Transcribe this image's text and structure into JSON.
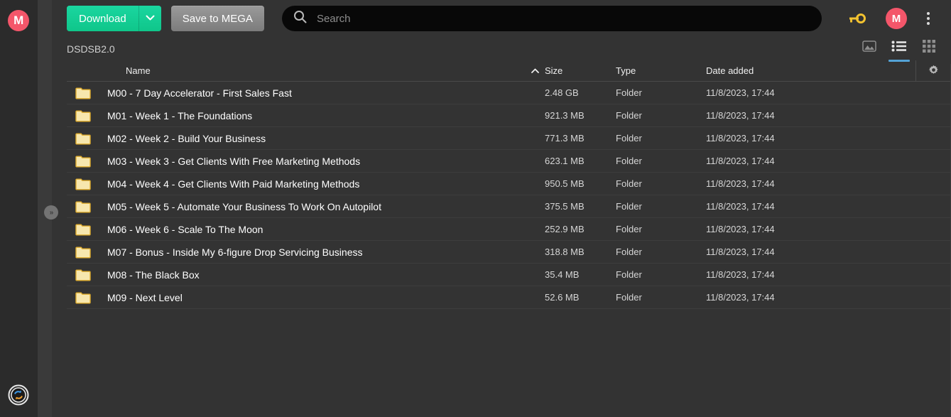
{
  "colors": {
    "accent_green": "#13cf92",
    "brand_red": "#f4566a",
    "key_yellow": "#f2c230",
    "active_blue": "#54a3d6",
    "panel_bg": "#333333",
    "rail_bg": "#2b2b2b",
    "folder_fill": "#f7e7ae"
  },
  "rail": {
    "logo_label": "M",
    "sync_icon": "sync-status-icon",
    "collapse_label": "»"
  },
  "toolbar": {
    "download_label": "Download",
    "download_caret_icon": "chevron-down-icon",
    "save_label": "Save to MEGA",
    "search": {
      "icon": "search-icon",
      "placeholder": "Search",
      "value": ""
    },
    "key_icon": "key-icon",
    "avatar_label": "M",
    "overflow_icon": "kebab-menu-icon"
  },
  "breadcrumb": {
    "path": "DSDSB2.0"
  },
  "view_toggles": [
    {
      "name": "media-view",
      "icon": "image-icon",
      "active": false
    },
    {
      "name": "list-view",
      "icon": "list-icon",
      "active": true
    },
    {
      "name": "grid-view",
      "icon": "grid-icon",
      "active": false
    }
  ],
  "table": {
    "columns": {
      "name": "Name",
      "size": "Size",
      "type": "Type",
      "date": "Date added"
    },
    "sort": {
      "column": "name",
      "direction": "asc",
      "icon": "caret-up-icon"
    },
    "settings_icon": "gear-icon",
    "rows": [
      {
        "icon": "folder-icon",
        "name": "M00 - 7 Day Accelerator - First Sales Fast",
        "size": "2.48 GB",
        "type": "Folder",
        "date": "11/8/2023, 17:44"
      },
      {
        "icon": "folder-icon",
        "name": "M01 - Week 1 - The Foundations",
        "size": "921.3 MB",
        "type": "Folder",
        "date": "11/8/2023, 17:44"
      },
      {
        "icon": "folder-icon",
        "name": "M02 - Week 2 - Build Your Business",
        "size": "771.3 MB",
        "type": "Folder",
        "date": "11/8/2023, 17:44"
      },
      {
        "icon": "folder-icon",
        "name": "M03 - Week 3 - Get Clients With Free Marketing Methods",
        "size": "623.1 MB",
        "type": "Folder",
        "date": "11/8/2023, 17:44"
      },
      {
        "icon": "folder-icon",
        "name": "M04 - Week 4 - Get Clients With Paid Marketing Methods",
        "size": "950.5 MB",
        "type": "Folder",
        "date": "11/8/2023, 17:44"
      },
      {
        "icon": "folder-icon",
        "name": "M05 - Week 5 - Automate Your Business To Work On Autopilot",
        "size": "375.5 MB",
        "type": "Folder",
        "date": "11/8/2023, 17:44"
      },
      {
        "icon": "folder-icon",
        "name": "M06 - Week 6 - Scale To The Moon",
        "size": "252.9 MB",
        "type": "Folder",
        "date": "11/8/2023, 17:44"
      },
      {
        "icon": "folder-icon",
        "name": "M07 - Bonus - Inside My 6-figure Drop Servicing Business",
        "size": "318.8 MB",
        "type": "Folder",
        "date": "11/8/2023, 17:44"
      },
      {
        "icon": "folder-icon",
        "name": "M08 - The Black Box",
        "size": "35.4 MB",
        "type": "Folder",
        "date": "11/8/2023, 17:44"
      },
      {
        "icon": "folder-icon",
        "name": "M09 - Next Level",
        "size": "52.6 MB",
        "type": "Folder",
        "date": "11/8/2023, 17:44"
      }
    ]
  }
}
